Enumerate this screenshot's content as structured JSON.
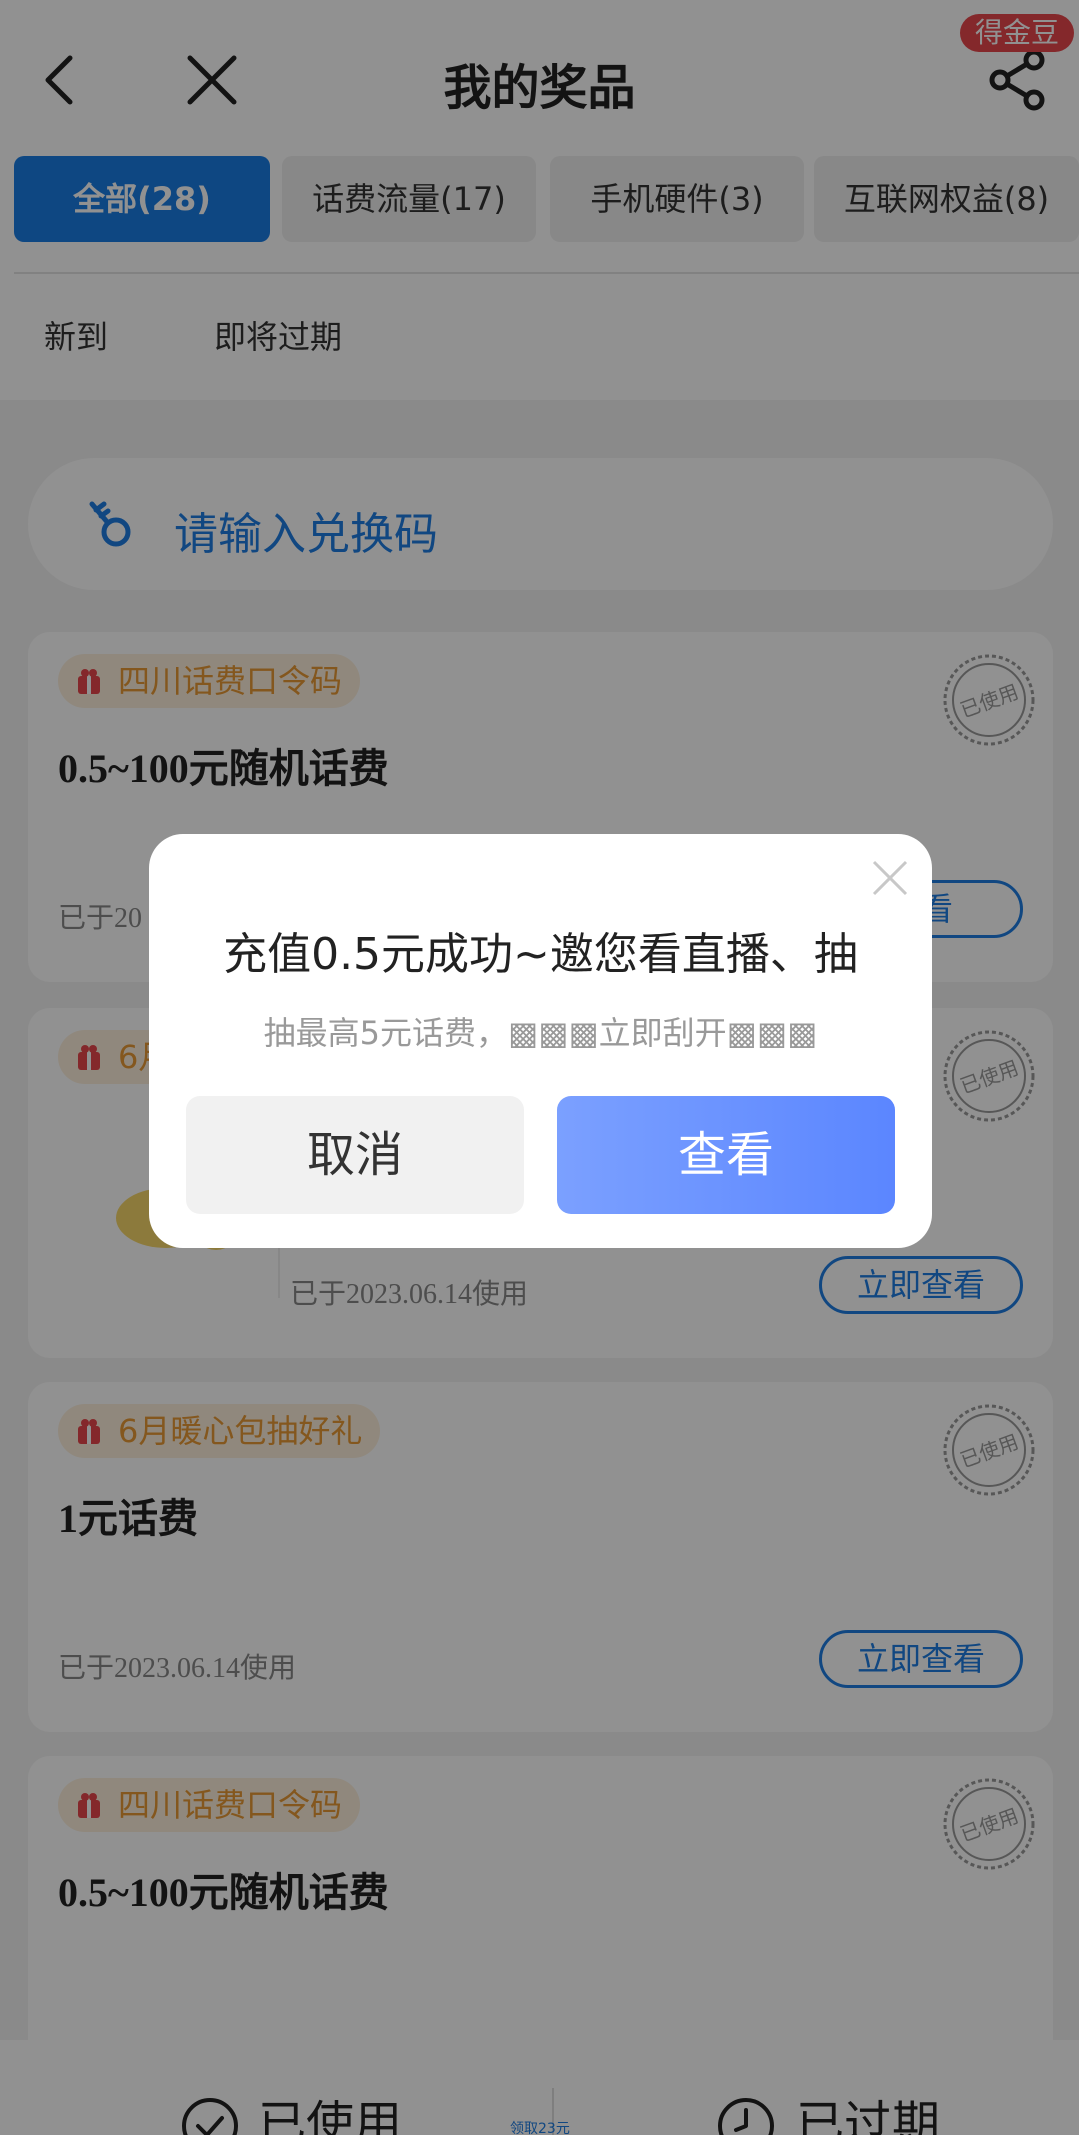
{
  "header": {
    "title": "我的奖品",
    "gold_badge": "得金豆"
  },
  "tabs": [
    {
      "label": "全部(28)",
      "active": true
    },
    {
      "label": "话费流量(17)",
      "active": false
    },
    {
      "label": "手机硬件(3)",
      "active": false
    },
    {
      "label": "互联网权益(8)",
      "active": false
    }
  ],
  "subtabs": [
    "新到",
    "即将过期"
  ],
  "redeem": {
    "placeholder": "请输入兑换码"
  },
  "stamp_text": "已使用",
  "cards": [
    {
      "tag": "四川话费口令码",
      "title": "0.5~100元随机话费",
      "used": "已于20",
      "button": "查看"
    },
    {
      "tag": "6月",
      "title": "",
      "used": "已于2023.06.14使用",
      "button": "立即查看"
    },
    {
      "tag": "6月暖心包抽好礼",
      "title": "1元话费",
      "used": "已于2023.06.14使用",
      "button": "立即查看"
    },
    {
      "tag": "四川话费口令码",
      "title": "0.5~100元随机话费",
      "used": "",
      "button": ""
    }
  ],
  "bottom_bar": {
    "used": "已使用",
    "expired": "已过期",
    "mid": "领取23元"
  },
  "modal": {
    "title": "充值0.5元成功~邀您看直播、抽",
    "subtitle": "抽最高5元话费，▩▩▩立即刮开▩▩▩",
    "cancel": "取消",
    "view": "查看"
  },
  "colors": {
    "brand_blue": "#1a7ee5",
    "tag_orange": "#e89a35",
    "badge_red": "#e8474c"
  }
}
